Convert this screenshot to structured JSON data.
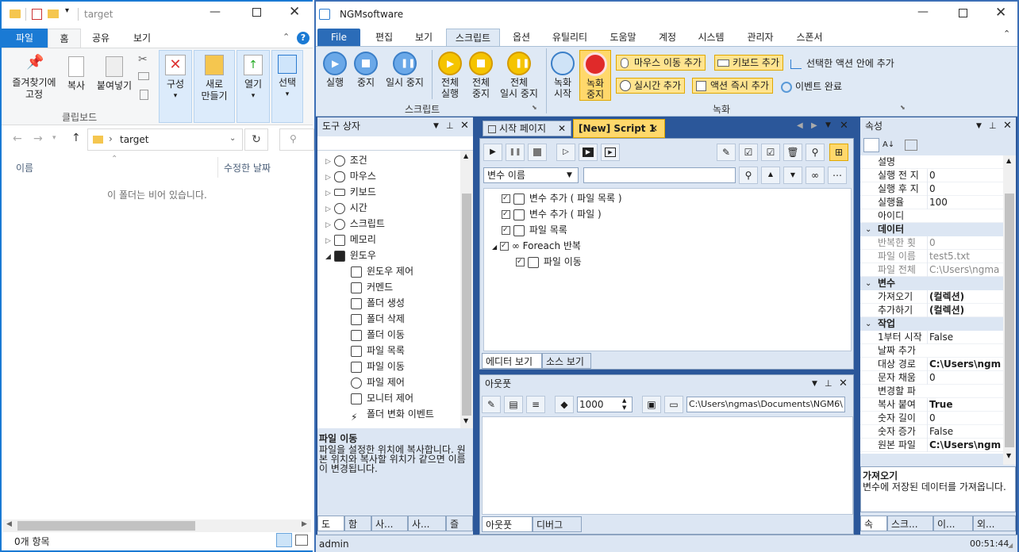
{
  "explorer": {
    "title": "target",
    "tabs": [
      "파일",
      "홈",
      "공유",
      "보기"
    ],
    "ribbon": {
      "pin_label": "즐겨찾기에\n고정",
      "copy_label": "복사",
      "paste_label": "붙여넣기",
      "clipboard_group": "클립보드",
      "organize_label": "구성",
      "new_label": "새로\n만들기",
      "open_label": "열기",
      "select_label": "선택"
    },
    "address": {
      "path": "target"
    },
    "columns": {
      "name": "이름",
      "modified": "수정한 날짜"
    },
    "empty_message": "이 폴더는 비어 있습니다.",
    "status": "0개 항목"
  },
  "ngm": {
    "title": "NGMsoftware",
    "menu_tabs": [
      "File",
      "편집",
      "보기",
      "스크립트",
      "옵션",
      "유틸리티",
      "도움말",
      "계정",
      "시스템",
      "관리자",
      "스폰서"
    ],
    "ribbon": {
      "run": "실행",
      "stop": "중지",
      "pause": "일시 중지",
      "run_all": "전체\n실행",
      "stop_all": "전체\n중지",
      "pause_all": "전체\n일시 중지",
      "script_group": "스크립트",
      "record_start": "녹화\n시작",
      "record_stop": "녹화\n중지",
      "record_group": "녹화",
      "mouse_move_add": "마우스 이동 추가",
      "keyboard_add": "키보드 추가",
      "add_in_selected": "선택한 액션 안에 추가",
      "realtime_add": "실시간 추가",
      "action_instant_add": "액션 즉시 추가",
      "event_complete": "이벤트 완료"
    },
    "toolbox": {
      "title": "도구 상자",
      "items": [
        "조건",
        "마우스",
        "키보드",
        "시간",
        "스크립트",
        "메모리",
        "윈도우"
      ],
      "window_children": [
        "윈도우 제어",
        "커멘드",
        "폴더 생성",
        "폴더 삭제",
        "폴더 이동",
        "파일 목록",
        "파일 이동",
        "파일 제어",
        "모니터 제어",
        "폴더 변화 이벤트"
      ],
      "desc_title": "파일 이동",
      "desc_text": "파일을 설정한 위치에 복사합니다. 원본 위치와 복사할 위치가 같으면 이름이 변경됩니다.",
      "bottom_tabs": [
        "도",
        "함",
        "사...",
        "사...",
        "즐"
      ]
    },
    "editor": {
      "tabs": [
        "시작 페이지",
        "[New] Script 1"
      ],
      "var_dropdown": "변수 이름",
      "nodes": [
        "변수 추가 ( 파일 목록 )",
        "변수 추가 ( 파일 )",
        "파일 목록",
        "Foreach 반복",
        "파일 이동"
      ],
      "bottom_tabs": [
        "에디터 보기",
        "소스 보기"
      ]
    },
    "output": {
      "title": "아웃풋",
      "count": "1000",
      "path": "C:\\Users\\ngmas\\Documents\\NGM6\\",
      "bottom_tabs": [
        "아웃풋",
        "디버그"
      ]
    },
    "props": {
      "title": "속성",
      "rows": [
        {
          "k": "설명",
          "v": "",
          "type": "row"
        },
        {
          "k": "실행 전 지",
          "v": "0",
          "type": "row"
        },
        {
          "k": "실행 후 지",
          "v": "0",
          "type": "row"
        },
        {
          "k": "실행율",
          "v": "100",
          "type": "row"
        },
        {
          "k": "아이디",
          "v": "",
          "type": "row"
        },
        {
          "k": "데이터",
          "v": "",
          "type": "sect"
        },
        {
          "k": "반복한 횟",
          "v": "0",
          "type": "gray"
        },
        {
          "k": "파일 이름",
          "v": "test5.txt",
          "type": "gray"
        },
        {
          "k": "파일 전체",
          "v": "C:\\Users\\ngma",
          "type": "gray"
        },
        {
          "k": "변수",
          "v": "",
          "type": "sect"
        },
        {
          "k": "가져오기",
          "v": "(컬렉션)",
          "type": "bold"
        },
        {
          "k": "추가하기",
          "v": "(컬렉션)",
          "type": "bold"
        },
        {
          "k": "작업",
          "v": "",
          "type": "sect"
        },
        {
          "k": "1부터 시작",
          "v": "False",
          "type": "row"
        },
        {
          "k": "날짜 추가",
          "v": "",
          "type": "row"
        },
        {
          "k": "대상 경로",
          "v": "C:\\Users\\ngm",
          "type": "bold"
        },
        {
          "k": "문자 채움",
          "v": "0",
          "type": "row"
        },
        {
          "k": "변경할 파",
          "v": "",
          "type": "row"
        },
        {
          "k": "복사 붙여",
          "v": "True",
          "type": "bold"
        },
        {
          "k": "숫자 길이",
          "v": "0",
          "type": "row"
        },
        {
          "k": "숫자 증가",
          "v": "False",
          "type": "row"
        },
        {
          "k": "원본 파일",
          "v": "C:\\Users\\ngm",
          "type": "bold"
        }
      ],
      "desc_title": "가져오기",
      "desc_text": "변수에 저장된 데이터를 가져옵니다.",
      "bottom_tabs": [
        "속",
        "스크...",
        "이...",
        "외..."
      ]
    },
    "status": {
      "user": "admin",
      "time": "00:51:44"
    }
  }
}
